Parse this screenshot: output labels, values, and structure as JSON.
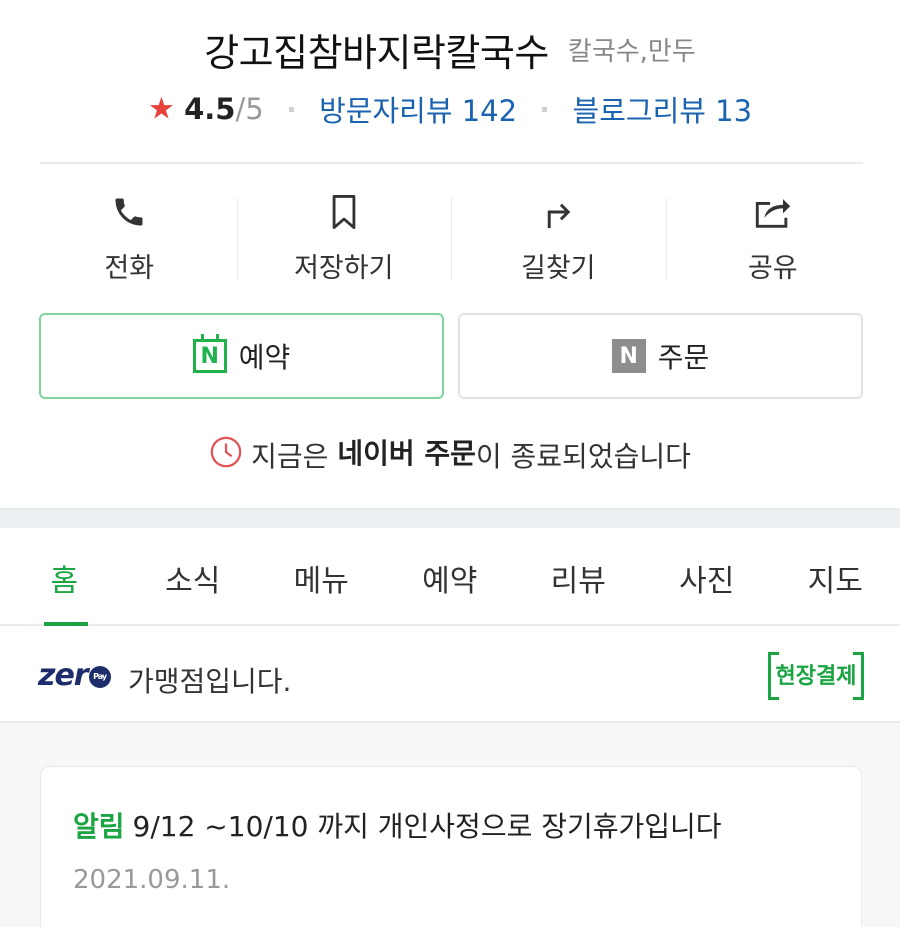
{
  "place": {
    "name": "강고집참바지락칼국수",
    "category": "칼국수,만두",
    "rating": "4.5",
    "rating_max": "/5",
    "visitor_reviews": "방문자리뷰 142",
    "blog_reviews": "블로그리뷰 13"
  },
  "actions": {
    "call": "전화",
    "save": "저장하기",
    "directions": "길찾기",
    "share": "공유"
  },
  "buttons": {
    "reserve_badge": "N",
    "reserve": "예약",
    "order_badge": "N",
    "order": "주문"
  },
  "order_notice": {
    "prefix": "지금은 ",
    "bold": "네이버 주문",
    "suffix": "이 종료되었습니다"
  },
  "tabs": [
    "홈",
    "소식",
    "메뉴",
    "예약",
    "리뷰",
    "사진",
    "지도"
  ],
  "active_tab": "홈",
  "zeropay": {
    "logo": "zer",
    "logo_pay": "Pay",
    "text": "가맹점입니다.",
    "onsite_badge": "현장결제"
  },
  "announcement": {
    "tag": "알림",
    "message": "9/12 ~10/10 까지 개인사정으로 장기휴가입니다",
    "date": "2021.09.11."
  },
  "colors": {
    "accent_green": "#1aa442",
    "link_blue": "#1a63b0",
    "star_red": "#e8403a",
    "zero_navy": "#1d2c6b"
  },
  "icons": {
    "call": "phone-icon",
    "save": "bookmark-icon",
    "directions": "turn-arrow-icon",
    "share": "share-icon",
    "clock": "clock-icon",
    "star": "star-icon"
  }
}
